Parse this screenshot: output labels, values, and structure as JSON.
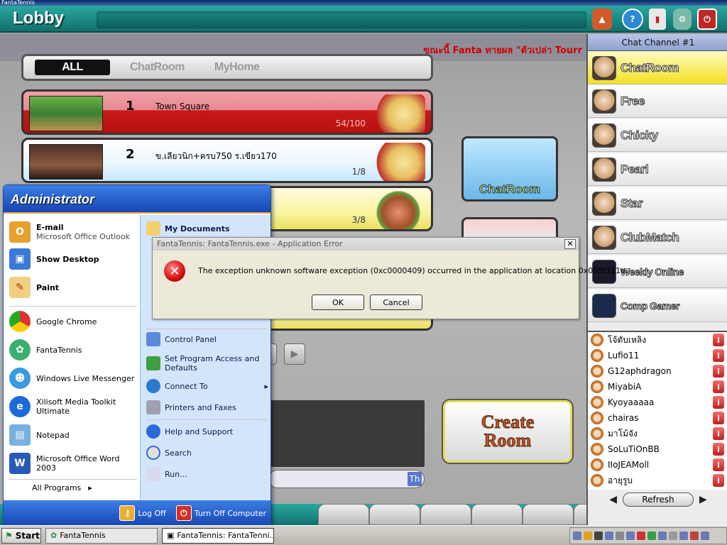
{
  "window": {
    "title": "FantaTennis"
  },
  "header": {
    "title": "Lobby",
    "icons": [
      "megaphone-icon",
      "help-icon",
      "book-icon",
      "gear-icon",
      "power-icon"
    ]
  },
  "marquee": {
    "text": "ขณะนี้ Fanta ทายผล \"ตัวเปล่า Tourr"
  },
  "tabs": [
    "ALL",
    "ChatRoom",
    "MyHome"
  ],
  "rooms": [
    {
      "number": "1",
      "name": "Town Square",
      "count": "54/100",
      "color": "#d8303a"
    },
    {
      "number": "2",
      "name": "ข.เลียวนิก+ครบ750 ร.เขียว170",
      "count": "1/8",
      "color": "#dff2ff"
    },
    {
      "number": "",
      "name": "",
      "count": "3/8",
      "color": "#f8f070"
    }
  ],
  "side_buttons": {
    "chatroom": "ChatRoom",
    "create_room_line1": "Create",
    "create_room_line2": "Room"
  },
  "chat": {
    "send": "Th"
  },
  "channel_panel": {
    "title": "Chat Channel #1",
    "channels": [
      "ChatRoom",
      "Free",
      "Chicky",
      "Pearl",
      "Star",
      "ClubMatch",
      "Weekly Online",
      "Comp Gamer"
    ],
    "selected": "ChatRoom",
    "users": [
      "โจ้ตับเหลิง",
      "Lufio11",
      "G12aphdragon",
      "MiyabiA",
      "Kyoyaaaaa",
      "chairas",
      "มาโม้จัง",
      "SoLuTiOnBB",
      "IIoJEAMoll",
      "อายุรูบ"
    ],
    "refresh": "Refresh"
  },
  "start_menu": {
    "user": "Administrator",
    "pinned": [
      {
        "title": "E-mail",
        "subtitle": "Microsoft Office Outlook"
      },
      {
        "title": "Show Desktop",
        "subtitle": ""
      },
      {
        "title": "Paint",
        "subtitle": ""
      }
    ],
    "recent": [
      "Google Chrome",
      "FantaTennis",
      "Windows Live Messenger",
      "Xilisoft Media Toolkit Ultimate",
      "Notepad",
      "Microsoft Office Word 2003"
    ],
    "all_programs": "All Programs",
    "right": {
      "my_documents": "My Documents",
      "control_panel": "Control Panel",
      "set_program_access": "Set Program Access and Defaults",
      "connect_to": "Connect To",
      "printers": "Printers and Faxes",
      "help": "Help and Support",
      "search": "Search",
      "run": "Run..."
    },
    "log_off": "Log Off",
    "turn_off": "Turn Off Computer"
  },
  "dialog": {
    "title": "FantaTennis: FantaTennis.exe - Application Error",
    "message": "The exception unknown software exception (0xc0000409) occurred in the application at location 0x005f321e.",
    "ok": "OK",
    "cancel": "Cancel"
  },
  "taskbar": {
    "start": "Start",
    "tasks": [
      "FantaTennis",
      "FantaTennis: FantaTenni..."
    ]
  }
}
